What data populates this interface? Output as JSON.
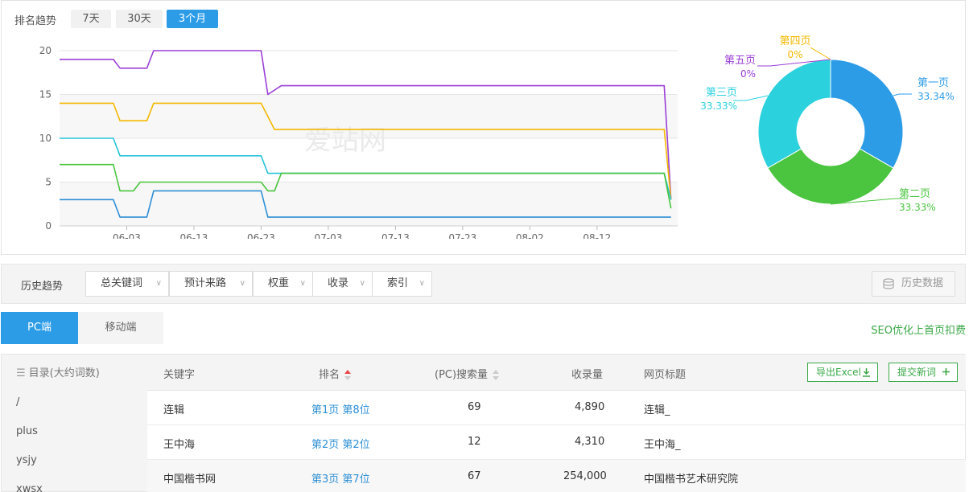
{
  "trend": {
    "title": "排名趋势",
    "ranges": [
      "7天",
      "30天",
      "3个月"
    ],
    "active_range": "3个月",
    "watermark": "爱站网"
  },
  "chart_data": [
    {
      "type": "line",
      "ylim": [
        0,
        20
      ],
      "yticks": [
        0,
        5,
        10,
        15,
        20
      ],
      "x_tick_labels": [
        "06-03",
        "06-13",
        "06-23",
        "07-03",
        "07-13",
        "07-23",
        "08-02",
        "08-12"
      ],
      "x_start": "05-24",
      "x_end": "08-24",
      "series": [
        {
          "color": "#9b3fd6",
          "points": [
            [
              "05-24",
              19
            ],
            [
              "06-01",
              19
            ],
            [
              "06-02",
              18
            ],
            [
              "06-06",
              18
            ],
            [
              "06-07",
              20
            ],
            [
              "06-23",
              20
            ],
            [
              "06-24",
              15
            ],
            [
              "06-26",
              16
            ],
            [
              "08-22",
              16
            ],
            [
              "08-23",
              3
            ]
          ]
        },
        {
          "color": "#f5b800",
          "points": [
            [
              "05-24",
              14
            ],
            [
              "06-01",
              14
            ],
            [
              "06-02",
              12
            ],
            [
              "06-06",
              12
            ],
            [
              "06-07",
              14
            ],
            [
              "06-23",
              14
            ],
            [
              "06-25",
              11
            ],
            [
              "08-22",
              11
            ],
            [
              "08-23",
              3
            ]
          ]
        },
        {
          "color": "#27c3d8",
          "points": [
            [
              "05-24",
              10
            ],
            [
              "06-01",
              10
            ],
            [
              "06-02",
              8
            ],
            [
              "06-23",
              8
            ],
            [
              "06-24",
              6
            ],
            [
              "08-22",
              6
            ],
            [
              "08-23",
              3
            ]
          ]
        },
        {
          "color": "#4bc53f",
          "points": [
            [
              "05-24",
              7
            ],
            [
              "06-01",
              7
            ],
            [
              "06-02",
              4
            ],
            [
              "06-04",
              4
            ],
            [
              "06-05",
              5
            ],
            [
              "06-23",
              5
            ],
            [
              "06-24",
              4
            ],
            [
              "06-25",
              4
            ],
            [
              "06-26",
              6
            ],
            [
              "08-22",
              6
            ],
            [
              "08-23",
              2
            ]
          ]
        },
        {
          "color": "#2d8fd5",
          "points": [
            [
              "05-24",
              3
            ],
            [
              "06-01",
              3
            ],
            [
              "06-02",
              1
            ],
            [
              "06-06",
              1
            ],
            [
              "06-07",
              4
            ],
            [
              "06-23",
              4
            ],
            [
              "06-24",
              1
            ],
            [
              "08-23",
              1
            ]
          ]
        }
      ]
    },
    {
      "type": "pie",
      "slices": [
        {
          "label": "第一页",
          "value": 33.34,
          "value_label": "33.34%",
          "color": "#2d9ce7"
        },
        {
          "label": "第二页",
          "value": 33.33,
          "value_label": "33.33%",
          "color": "#4bc53f"
        },
        {
          "label": "第三页",
          "value": 33.33,
          "value_label": "33.33%",
          "color": "#2bd1dd"
        },
        {
          "label": "第四页",
          "value": 0,
          "value_label": "0%",
          "color": "#f5b800"
        },
        {
          "label": "第五页",
          "value": 0,
          "value_label": "0%",
          "color": "#9b3fd6"
        }
      ]
    }
  ],
  "history": {
    "title": "历史趋势",
    "dropdowns": [
      "总关键词",
      "预计来路",
      "权重",
      "收录",
      "索引"
    ],
    "data_button": "历史数据"
  },
  "tabs": [
    "PC端",
    "移动端"
  ],
  "promo_link": "SEO优化上首页扣费",
  "sidebar": {
    "heading": "目录(大约词数)",
    "items": [
      "/",
      "plus",
      "ysjy",
      "xwsx"
    ]
  },
  "table": {
    "headers": {
      "keyword": "关键字",
      "rank": "排名",
      "search_volume": "(PC)搜索量",
      "indexed": "收录量",
      "page_title": "网页标题"
    },
    "export_btn": "导出Excel",
    "submit_btn": "提交新词",
    "rows": [
      {
        "keyword": "连辑",
        "rank": "第1页 第8位",
        "search_volume": "69",
        "indexed": "4,890",
        "page_title": "连辑_"
      },
      {
        "keyword": "王中海",
        "rank": "第2页 第2位",
        "search_volume": "12",
        "indexed": "4,310",
        "page_title": "王中海_"
      },
      {
        "keyword": "中国楷书网",
        "rank": "第3页 第7位",
        "search_volume": "67",
        "indexed": "254,000",
        "page_title": "中国楷书艺术研究院"
      }
    ]
  }
}
